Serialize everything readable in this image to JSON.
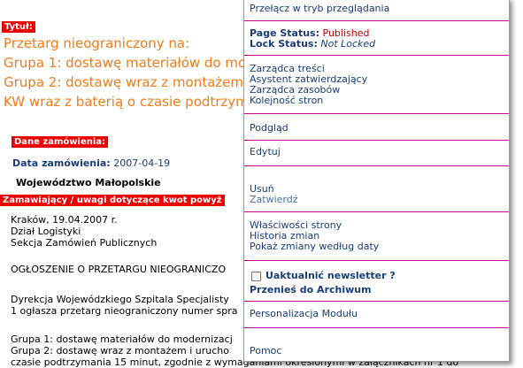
{
  "doc": {
    "title_tag": "Tytuł:",
    "title_lines": [
      "Przetarg nieograniczony na:",
      "Grupa 1: dostawę materiałów do mo",
      "Grupa 2: dostawę wraz z montażem",
      "KW wraz z baterią o czasie podtrzym"
    ],
    "order_tag": "Dane zamówienia:",
    "order_date_label": "Data zamówienia:",
    "order_date_value": "2007-04-19",
    "region": "Województwo Małopolskie",
    "buyer_tag": "Zamawiający / uwagi dotyczące kwot powyż",
    "body_lines": [
      "Kraków, 19.04.2007 r.",
      "Dział Logistyki",
      "Sekcja Zamówień Publicznych",
      "OGŁOSZENIE O PRZETARGU NIEOGRANICZO",
      "Dyrekcja Wojewódzkiego Szpitala Specjalisty",
      "1 ogłasza przetarg nieograniczony numer spra",
      "Grupa 1: dostawę materiałów do modernizacj",
      "Grupa 2:  dostawę wraz z montażem i urucho",
      "czasie podtrzymania 15 minut, zgodnie z wymaganiami określonymi w załącznikach nr 1 do"
    ]
  },
  "menu": {
    "switch_view": "Przełącz w tryb przeglądania",
    "page_status_label": "Page Status:",
    "page_status_value": "Published",
    "lock_status_label": "Lock Status:",
    "lock_status_value": "Not Locked",
    "group1": [
      "Zarządca treści",
      "Asystent zatwierdzający",
      "Zarządca zasobów",
      "Kolejność stron"
    ],
    "preview": "Podgląd",
    "edit": "Edytuj",
    "delete": "Usuń",
    "approve": "Zatwierdź",
    "group2": [
      "Właściwości strony",
      "Historia zmian",
      "Pokaż zmiany według daty"
    ],
    "newsletter": "Uaktualnić newsletter ?",
    "archive": "Przenieś do Archiwum",
    "personalize": "Personalizacja Modułu",
    "help": "Pomoc"
  },
  "colors": {
    "menu_separator": "#cc0099",
    "status_published": "#cc0000",
    "title_orange": "#f07c1a",
    "tag_red": "#ee0000",
    "link_navy": "#1a3c7a"
  }
}
